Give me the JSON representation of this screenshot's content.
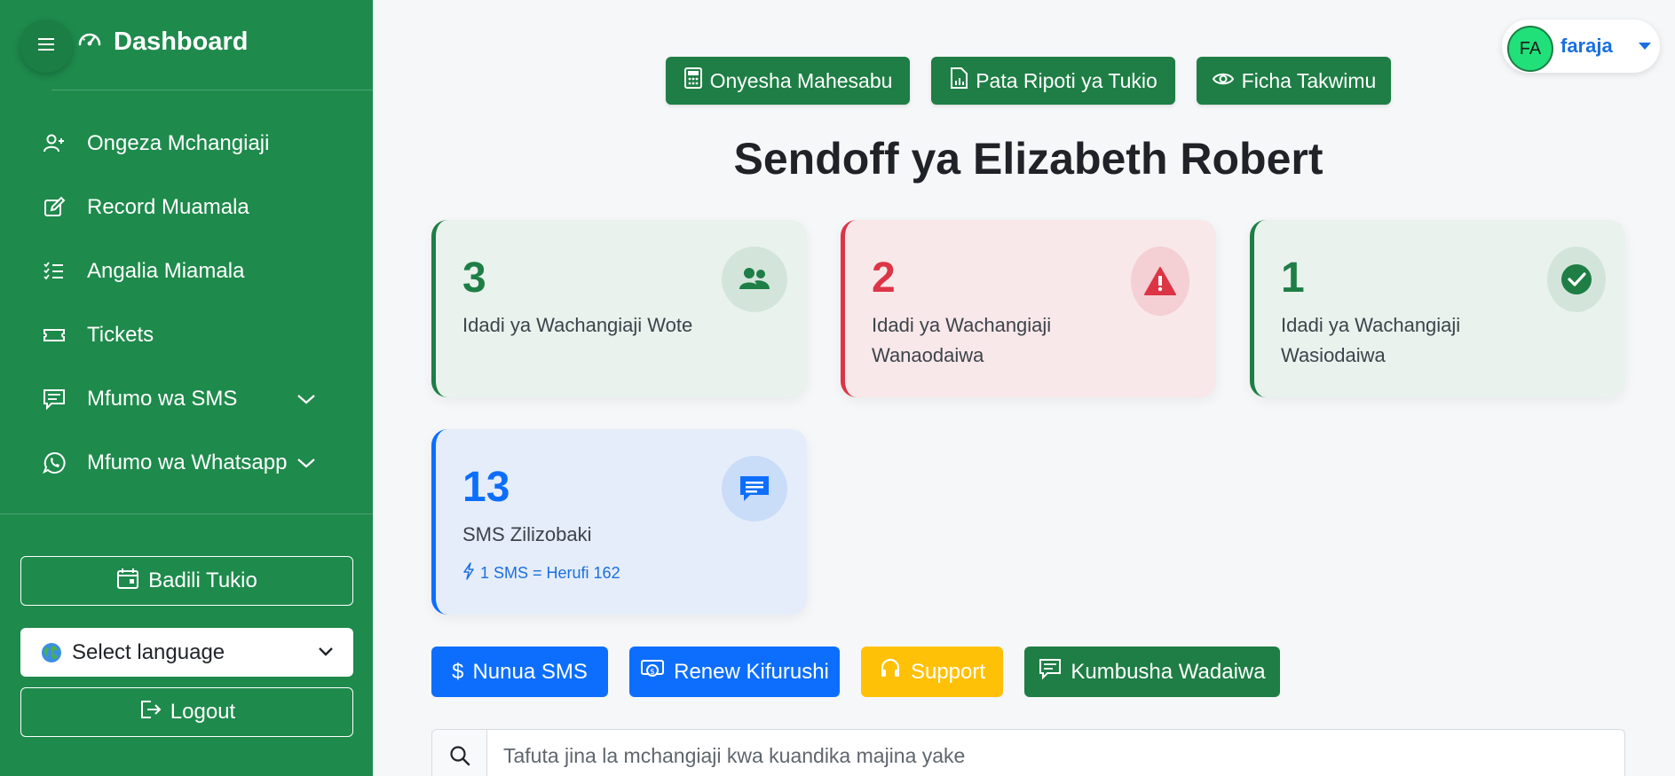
{
  "sidebar": {
    "brand_title": "Dashboard",
    "menu": [
      {
        "label": "Ongeza Mchangiaji",
        "icon": "user-plus-icon"
      },
      {
        "label": "Record Muamala",
        "icon": "pencil-square-icon"
      },
      {
        "label": "Angalia Miamala",
        "icon": "list-check-icon"
      },
      {
        "label": "Tickets",
        "icon": "ticket-icon"
      },
      {
        "label": "Mfumo wa SMS",
        "icon": "sms-icon",
        "has_submenu": true
      },
      {
        "label": "Mfumo wa Whatsapp",
        "icon": "whatsapp-icon",
        "has_submenu": true
      }
    ],
    "switch_event_label": "Badili Tukio",
    "language_select": {
      "selected": "Select language"
    },
    "logout_label": "Logout",
    "bg_color": "#1e8a4c"
  },
  "header": {
    "buttons": [
      {
        "label": "Onyesha Mahesabu",
        "icon": "calculator-icon"
      },
      {
        "label": "Pata Ripoti ya Tukio",
        "icon": "report-icon"
      },
      {
        "label": "Ficha Takwimu",
        "icon": "eye-icon"
      }
    ],
    "user": {
      "initials": "FA",
      "name": "faraja"
    }
  },
  "page_title": "Sendoff ya Elizabeth Robert",
  "stats": [
    {
      "value": "3",
      "label": "Idadi ya Wachangiaji Wote",
      "color": "#1e7e45",
      "icon": "users-icon"
    },
    {
      "value": "2",
      "label": "Idadi ya Wachangiaji Wanaodaiwa",
      "color": "#dc3545",
      "icon": "warning-icon"
    },
    {
      "value": "1",
      "label": "Idadi ya Wachangiaji Wasiodaiwa",
      "color": "#1e7e45",
      "icon": "check-circle-icon"
    },
    {
      "value": "13",
      "label": "SMS Zilizobaki",
      "color": "#0d6efd",
      "icon": "chat-icon",
      "note": "1 SMS = Herufi 162"
    }
  ],
  "actions": [
    {
      "label": "Nunua SMS",
      "icon": "dollar-icon",
      "color": "#0d6efd"
    },
    {
      "label": "Renew Kifurushi",
      "icon": "renew-icon",
      "color": "#0d6efd"
    },
    {
      "label": "Support",
      "icon": "headset-icon",
      "color": "#ffc107"
    },
    {
      "label": "Kumbusha Wadaiwa",
      "icon": "message-icon",
      "color": "#1e7e45"
    }
  ],
  "search": {
    "placeholder": "Tafuta jina la mchangiaji kwa kuandika majina yake"
  }
}
